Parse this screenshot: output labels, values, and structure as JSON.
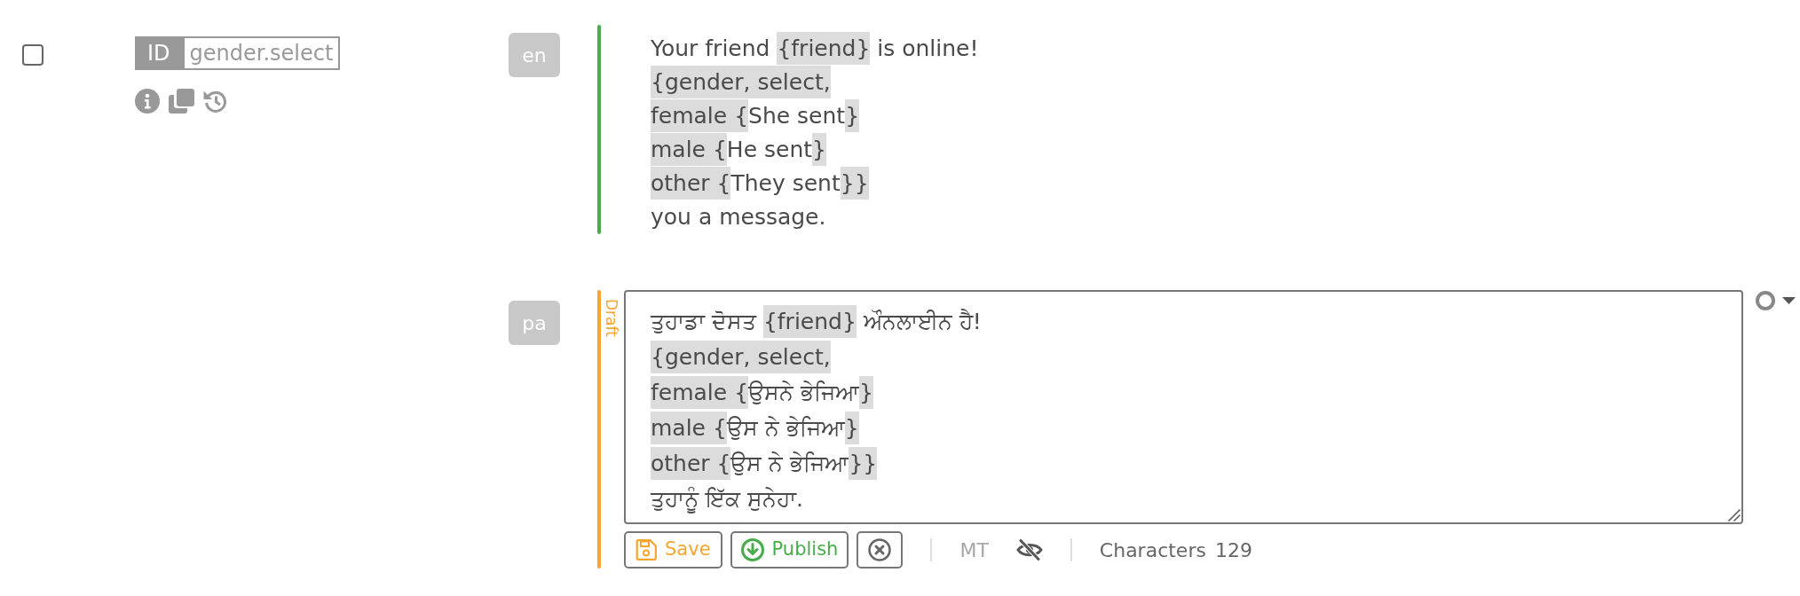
{
  "row": {
    "checked": false,
    "key": {
      "label": "ID",
      "value": "gender.select"
    }
  },
  "entries": [
    {
      "kind": "source",
      "language": "en",
      "color": "#47ad4a",
      "lines": [
        [
          {
            "kind": "text",
            "text": "Your friend "
          },
          {
            "kind": "syntax",
            "text": "{friend}"
          },
          {
            "kind": "text",
            "text": " is online!"
          }
        ],
        [
          {
            "kind": "syntax",
            "text": "{gender, select,"
          }
        ],
        [
          {
            "kind": "syntax",
            "text": "female {"
          },
          {
            "kind": "text",
            "text": "She sent"
          },
          {
            "kind": "syntax",
            "text": "}"
          }
        ],
        [
          {
            "kind": "syntax",
            "text": "male {"
          },
          {
            "kind": "text",
            "text": "He sent"
          },
          {
            "kind": "syntax",
            "text": "}"
          }
        ],
        [
          {
            "kind": "syntax",
            "text": "other {"
          },
          {
            "kind": "text",
            "text": "They sent"
          },
          {
            "kind": "syntax",
            "text": "}}"
          }
        ],
        [
          {
            "kind": "text",
            "text": "you a message."
          }
        ]
      ]
    },
    {
      "kind": "translation",
      "language": "pa",
      "color": "#f6a52f",
      "status": "Draft",
      "lines": [
        [
          {
            "kind": "text",
            "text": "ਤੁਹਾਡਾ ਦੋਸਤ "
          },
          {
            "kind": "syntax",
            "text": "{friend}"
          },
          {
            "kind": "text",
            "text": " ਔਨਲਾਈਨ ਹੈ!"
          }
        ],
        [
          {
            "kind": "syntax",
            "text": "{gender, select,"
          }
        ],
        [
          {
            "kind": "syntax",
            "text": "female {"
          },
          {
            "kind": "text",
            "text": "ਉਸਨੇ ਭੇਜਿਆ"
          },
          {
            "kind": "syntax",
            "text": "}"
          }
        ],
        [
          {
            "kind": "syntax",
            "text": "male {"
          },
          {
            "kind": "text",
            "text": "ਉਸ ਨੇ ਭੇਜਿਆ"
          },
          {
            "kind": "syntax",
            "text": "}"
          }
        ],
        [
          {
            "kind": "syntax",
            "text": "other {"
          },
          {
            "kind": "text",
            "text": "ਉਸ ਨੇ ਭੇਜਿਆ"
          },
          {
            "kind": "syntax",
            "text": "}}"
          }
        ],
        [
          {
            "kind": "text",
            "text": "ਤੁਹਾਨੂੰ ਇੱਕ ਸੁਨੇਹਾ."
          }
        ]
      ],
      "toolbar": {
        "actions": [
          {
            "kind": "save",
            "label": "Save"
          },
          {
            "kind": "publish",
            "label": "Publish"
          },
          {
            "kind": "cancel"
          }
        ],
        "mt": {
          "label": "MT",
          "disabled": true
        },
        "characters": {
          "label": "Characters",
          "count": "129"
        }
      }
    }
  ]
}
